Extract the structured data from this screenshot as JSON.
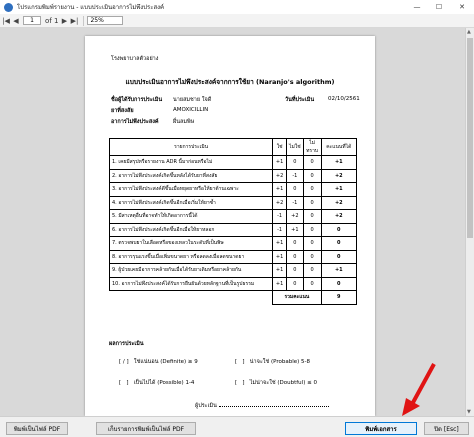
{
  "window": {
    "title": "โปรแกรมพิมพ์รายงาน - แบบประเมินอาการไม่พึงประสงค์",
    "minimize": "—",
    "maximize": "☐",
    "close": "✕"
  },
  "toolbar": {
    "first_label": "|◀",
    "prev_label": "◀",
    "page_value": "1",
    "page_of": "of 1",
    "next_label": "▶",
    "last_label": "▶|",
    "zoom_value": "25%"
  },
  "document": {
    "org_name": "โรงพยาบาลตัวอย่าง",
    "title": "แบบประเมินอาการไม่พึงประสงค์จากการใช้ยา (Naranjo's algorithm)",
    "patient_label": "ชื่อผู้ได้รับการประเมิน",
    "patient_value": "นายสมชาย ใจดี",
    "date_label": "วันที่ประเมิน",
    "date_value": "02/10/2561",
    "drug_label": "ยาที่สงสัย",
    "drug_value": "AMOXICILLIN",
    "adr_label": "อาการไม่พึงประสงค์",
    "adr_value": "ผื่นลมพิษ",
    "table_headers": [
      "รายการประเมิน",
      "ใช่",
      "ไม่ใช่",
      "ไม่ทราบ",
      "คะแนนที่ได้"
    ],
    "rows": [
      {
        "q": "1. เคยมีสรุปหรือรายงาน ADR นี้มาก่อนหรือไม่",
        "yes": "+1",
        "no": "0",
        "unk": "0",
        "score": "+1"
      },
      {
        "q": "2. อาการไม่พึงประสงค์เกิดขึ้นหลังได้รับยาที่สงสัย",
        "yes": "+2",
        "no": "-1",
        "unk": "0",
        "score": "+2"
      },
      {
        "q": "3. อาการไม่พึงประสงค์ดีขึ้นเมื่อหยุดยาหรือให้ยาต้านเฉพาะ",
        "yes": "+1",
        "no": "0",
        "unk": "0",
        "score": "+1"
      },
      {
        "q": "4. อาการไม่พึงประสงค์เกิดขึ้นอีกเมื่อเริ่มให้ยาซ้ำ",
        "yes": "+2",
        "no": "-1",
        "unk": "0",
        "score": "+2"
      },
      {
        "q": "5. มีสาเหตุอื่นที่อาจทำให้เกิดอาการนี้ได้",
        "yes": "-1",
        "no": "+2",
        "unk": "0",
        "score": "+2"
      },
      {
        "q": "6. อาการไม่พึงประสงค์เกิดขึ้นอีกเมื่อให้ยาหลอก",
        "yes": "-1",
        "no": "+1",
        "unk": "0",
        "score": "0"
      },
      {
        "q": "7. ตรวจพบยาในเลือดหรือของเหลวในระดับที่เป็นพิษ",
        "yes": "+1",
        "no": "0",
        "unk": "0",
        "score": "0"
      },
      {
        "q": "8. อาการรุนแรงขึ้นเมื่อเพิ่มขนาดยา หรือลดลงเมื่อลดขนาดยา",
        "yes": "+1",
        "no": "0",
        "unk": "0",
        "score": "0"
      },
      {
        "q": "9. ผู้ป่วยเคยมีอาการคล้ายกันเมื่อได้รับยาเดิมหรือยาคล้ายกัน",
        "yes": "+1",
        "no": "0",
        "unk": "0",
        "score": "+1"
      },
      {
        "q": "10. อาการไม่พึงประสงค์ได้รับการยืนยันด้วยหลักฐานที่เป็นรูปธรรม",
        "yes": "+1",
        "no": "0",
        "unk": "0",
        "score": "0"
      }
    ],
    "total_label": "รวมคะแนน",
    "total_value": "9",
    "result_title": "ผลการประเมิน",
    "opt1_mark": "/",
    "opt1": "ใช่แน่นอน (Definite) ≥ 9",
    "opt2": "น่าจะใช่ (Probable) 5-8",
    "opt3": "เป็นไปได้ (Possible) 1-4",
    "opt4": "ไม่น่าจะใช่ (Doubtful) ≤ 0",
    "assessor_label": "ผู้ประเมิน"
  },
  "bottom": {
    "btn_pdf": "พิมพ์เป็นไฟล์ PDF",
    "btn_save_pdf": "เก็บรายการพิมพ์เป็นไฟล์ PDF",
    "btn_print": "พิมพ์เอกสาร",
    "btn_close": "ปิด [Esc]"
  },
  "colors": {
    "arrow": "#e01414",
    "primary_border": "#0078d7"
  }
}
